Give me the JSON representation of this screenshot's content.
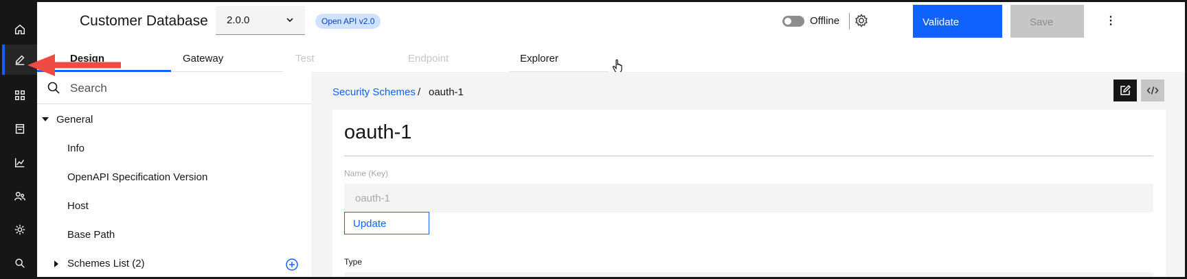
{
  "header": {
    "app_title": "Customer Database",
    "version_select": {
      "selected": "2.0.0"
    },
    "api_badge": "Open API v2.0",
    "offline_toggle": {
      "label": "Offline",
      "on": false
    },
    "validate_label": "Validate",
    "save_label": "Save",
    "overflow_label": "⋮"
  },
  "tabs": [
    {
      "label": "Design",
      "active": true,
      "disabled": false
    },
    {
      "label": "Gateway",
      "active": false,
      "disabled": false
    },
    {
      "label": "Test",
      "active": false,
      "disabled": true
    },
    {
      "label": "Endpoint",
      "active": false,
      "disabled": true
    },
    {
      "label": "Explorer",
      "active": false,
      "disabled": false
    }
  ],
  "rail": {
    "items": [
      {
        "icon": "home-icon"
      },
      {
        "icon": "edit-icon",
        "active": true
      },
      {
        "icon": "apps-icon"
      },
      {
        "icon": "catalog-icon"
      },
      {
        "icon": "analytics-icon"
      },
      {
        "icon": "users-icon"
      },
      {
        "icon": "settings-icon"
      },
      {
        "icon": "search-icon"
      }
    ]
  },
  "left_panel": {
    "search": {
      "placeholder": "Search",
      "value": ""
    },
    "tree": {
      "general_label": "General",
      "info_label": "Info",
      "openapi_version_label": "OpenAPI Specification Version",
      "host_label": "Host",
      "base_path_label": "Base Path",
      "schemes_label": "Schemes List (2)"
    }
  },
  "main": {
    "breadcrumb": {
      "parent": "Security Schemes",
      "separator": "/",
      "current": "oauth-1"
    },
    "form": {
      "title": "oauth-1",
      "name_label": "Name (Key)",
      "name_value": "oauth-1",
      "update_label": "Update",
      "type_label": "Type"
    }
  },
  "colors": {
    "accent": "#0f62fe",
    "rail_bg": "#161616",
    "annotation_arrow": "#f04a45"
  }
}
